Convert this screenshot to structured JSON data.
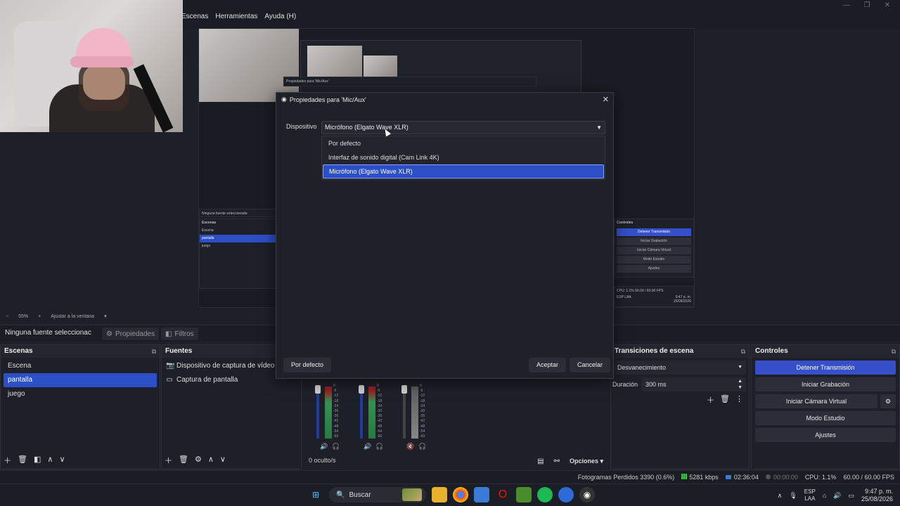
{
  "menu": [
    "Escenas",
    "Herramientas",
    "Ayuda (H)"
  ],
  "zoom": {
    "minus": "−",
    "value": "55%",
    "plus": "+",
    "fit": "Ajustar a la ventana"
  },
  "sourcebar": {
    "no_selection": "Ninguna fuente seleccionac",
    "properties": "Propiedades",
    "filters": "Filtros"
  },
  "scenes": {
    "title": "Escenas",
    "items": [
      "Escena",
      "pantalla",
      "juego"
    ],
    "selected": 1
  },
  "sources": {
    "title": "Fuentes",
    "items": [
      "Dispositivo de captura de vídeo",
      "Captura de pantalla"
    ]
  },
  "mixer": {
    "hidden": "0 oculto/s",
    "options": "Opciones",
    "scale": [
      "0",
      "-6",
      "-12",
      "-18",
      "-24",
      "-30",
      "-36",
      "-42",
      "-48",
      "-54",
      "-60"
    ]
  },
  "transitions": {
    "title": "Transiciones de escena",
    "type": "Desvanecimiento",
    "duration_label": "Duración",
    "duration": "300 ms"
  },
  "controls": {
    "title": "Controles",
    "buttons": [
      "Detener Transmisión",
      "Iniciar Grabación",
      "Iniciar Cámara Virtual",
      "Modo Estudio",
      "Ajustes"
    ]
  },
  "status": {
    "dropped": "Fotogramas Perdidos 3390 (0.6%)",
    "bitrate": "5281 kbps",
    "stream_time": "02:36:04",
    "rec_time": "00:00:00",
    "cpu": "CPU: 1.1%",
    "fps": "60.00 / 60.00 FPS"
  },
  "taskbar": {
    "search": "Buscar",
    "lang1": "ESP",
    "lang2": "LAA",
    "time": "9:47 p. m.",
    "date": "25/08/2026"
  },
  "dialog": {
    "title": "Propiedades para 'Mic/Aux'",
    "device_label": "Dispositivo",
    "device_value": "Micrófono (Elgato Wave XLR)",
    "options": [
      "Por defecto",
      "Interfaz de sonido digital (Cam Link 4K)",
      "Micrófono (Elgato Wave XLR)"
    ],
    "selected": 2,
    "defaults_button": "Por defecto",
    "accept_button": "Aceptar",
    "cancel_button": "Cancelar"
  },
  "preview": {
    "mini_title": "Propiedades para 'Mic/Aux'",
    "mini_nosel": "Ninguna fuente seleccionada",
    "mini_props": "Propiedades",
    "mini_scenes_title": "Escenas",
    "mini_scenes": [
      "Escena",
      "pantalla",
      "juego"
    ],
    "mini_controls_title": "Controles",
    "mini_controls": [
      "Detener Transmisión",
      "Iniciar Grabación",
      "Iniciar Cámara Virtual",
      "Modo Estudio",
      "Ajustes"
    ],
    "mini_status": "CPU: 1.1%   60.00 / 60.00 FPS",
    "mini_lang": "ESP LAA",
    "mini_time": "9:47 p. m.",
    "mini_date": "25/08/2026"
  },
  "colors": {
    "accent": "#2c4fc7",
    "button_blue": "#3550c8",
    "bg": "#1e2029"
  },
  "icons": [
    "gear-icon",
    "filter-icon",
    "camera-icon",
    "monitor-icon",
    "plus-icon",
    "trash-icon",
    "up-icon",
    "down-icon",
    "speaker-icon",
    "headphones-icon",
    "search-icon",
    "windows-icon",
    "close-icon",
    "obs-icon"
  ]
}
